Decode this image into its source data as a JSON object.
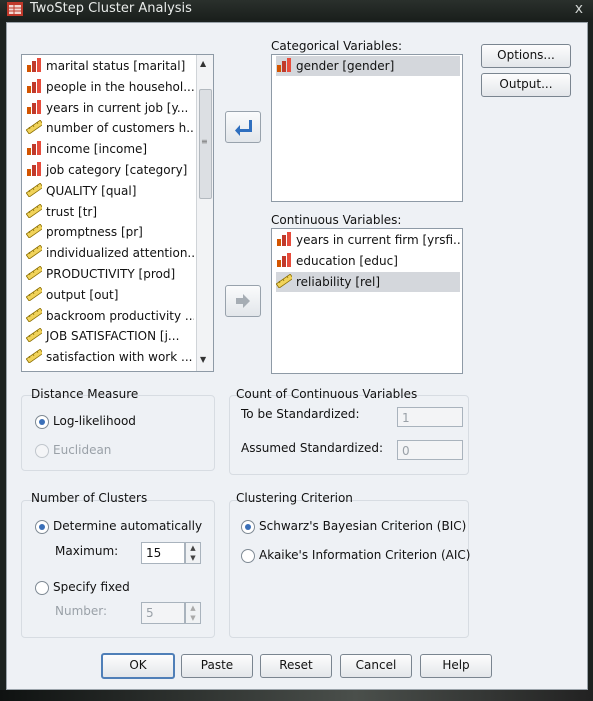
{
  "window": {
    "title": "TwoStep Cluster Analysis",
    "close_glyph": "x"
  },
  "variable_list": [
    {
      "label": "marital status [marital]",
      "icon": "nominal-icon"
    },
    {
      "label": "people in the househol...",
      "icon": "nominal-icon"
    },
    {
      "label": "years in current job [y...",
      "icon": "nominal-icon"
    },
    {
      "label": "number of customers h...",
      "icon": "scale-icon"
    },
    {
      "label": "income [income]",
      "icon": "nominal-icon"
    },
    {
      "label": "job category [category]",
      "icon": "nominal-icon"
    },
    {
      "label": "QUALITY [qual]",
      "icon": "scale-icon"
    },
    {
      "label": "trust [tr]",
      "icon": "scale-icon"
    },
    {
      "label": "promptness [pr]",
      "icon": "scale-icon"
    },
    {
      "label": "individualized attention...",
      "icon": "scale-icon"
    },
    {
      "label": "PRODUCTIVITY [prod]",
      "icon": "scale-icon"
    },
    {
      "label": "output [out]",
      "icon": "scale-icon"
    },
    {
      "label": "backroom productivity ...",
      "icon": "scale-icon"
    },
    {
      "label": "JOB SATISFACTION [j...",
      "icon": "scale-icon"
    },
    {
      "label": "satisfaction with work ...",
      "icon": "scale-icon"
    }
  ],
  "categorical": {
    "heading": "Categorical Variables:",
    "items": [
      {
        "label": "gender [gender]",
        "icon": "nominal-icon",
        "selected": true
      }
    ]
  },
  "continuous": {
    "heading": "Continuous Variables:",
    "items": [
      {
        "label": "years in current firm [yrsfi...",
        "icon": "nominal-icon",
        "selected": false
      },
      {
        "label": "education [educ]",
        "icon": "nominal-icon",
        "selected": false
      },
      {
        "label": "reliability [rel]",
        "icon": "scale-icon",
        "selected": true
      }
    ]
  },
  "side_buttons": {
    "options": "Options...",
    "output": "Output..."
  },
  "distance_measure": {
    "heading": "Distance Measure",
    "log_likelihood": "Log-likelihood",
    "euclidean": "Euclidean"
  },
  "count_continuous": {
    "heading": "Count of Continuous Variables",
    "to_be_standardized_label": "To be Standardized:",
    "to_be_standardized_value": "1",
    "assumed_standardized_label": "Assumed Standardized:",
    "assumed_standardized_value": "0"
  },
  "number_of_clusters": {
    "heading": "Number of Clusters",
    "determine_auto": "Determine automatically",
    "maximum_label": "Maximum:",
    "maximum_value": "15",
    "specify_fixed": "Specify fixed",
    "number_label": "Number:",
    "number_value": "5"
  },
  "clustering_criterion": {
    "heading": "Clustering Criterion",
    "bic": "Schwarz's Bayesian Criterion (BIC)",
    "aic": "Akaike's Information Criterion (AIC)"
  },
  "buttons": {
    "ok": "OK",
    "paste": "Paste",
    "reset": "Reset",
    "cancel": "Cancel",
    "help": "Help"
  },
  "colors": {
    "accent": "#3a6fb8",
    "selection": "#d4d7dc",
    "arrow": "#2f6fbf"
  }
}
